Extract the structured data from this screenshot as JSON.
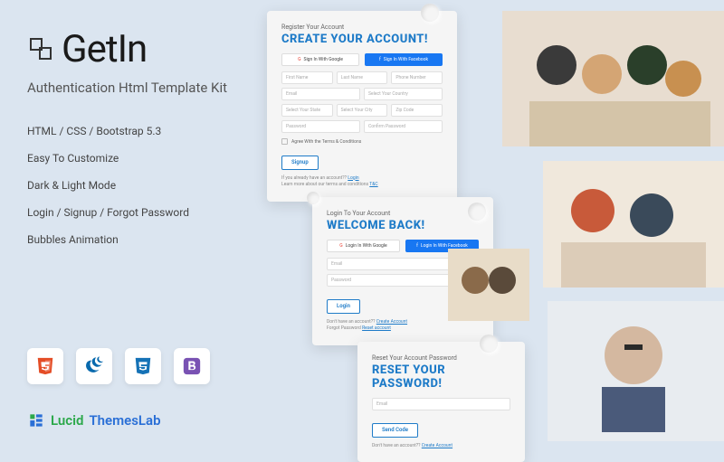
{
  "brand_name": "GetIn",
  "subtitle": "Authentication Html Template Kit",
  "features": [
    "HTML / CSS / Bootstrap 5.3",
    "Easy To Customize",
    "Dark & Light Mode",
    "Login / Signup / Forgot Password",
    "Bubbles Animation"
  ],
  "footer_brand": {
    "left": "Lucid",
    "right": "ThemesLab"
  },
  "signup": {
    "pretitle": "Register Your Account",
    "title": "CREATE YOUR ACCOUNT!",
    "google": "Sign In With Google",
    "facebook": "Sign In With Facebook",
    "fields": {
      "first": "First Name",
      "last": "Last Name",
      "phone": "Phone Number",
      "email": "Email",
      "country": "Select Your Country",
      "state": "Select Your State",
      "city": "Select Your City",
      "zip": "Zip Code",
      "password": "Password",
      "confirm": "Confirm Password"
    },
    "terms": "Agree With the Terms & Conditions",
    "button": "Signup",
    "already": "If you already have an account??",
    "login_link": "Login",
    "learn": "Learn more about our terms and conditions",
    "tc_link": "T&C"
  },
  "login": {
    "pretitle": "Login To Your Account",
    "title": "WELCOME BACK!",
    "google": "Login In With Google",
    "facebook": "Login In With Facebook",
    "email": "Email",
    "password": "Password",
    "button": "Login",
    "no_account": "Don't have an account??",
    "create_link": "Create Account",
    "forgot": "Forgot Password",
    "reset_link": "Reset account"
  },
  "reset": {
    "pretitle": "Reset Your Account Password",
    "title": "RESET YOUR PASSWORD!",
    "email": "Email",
    "button": "Send Code",
    "no_account": "Don't have an account??",
    "create_link": "Create Account"
  }
}
